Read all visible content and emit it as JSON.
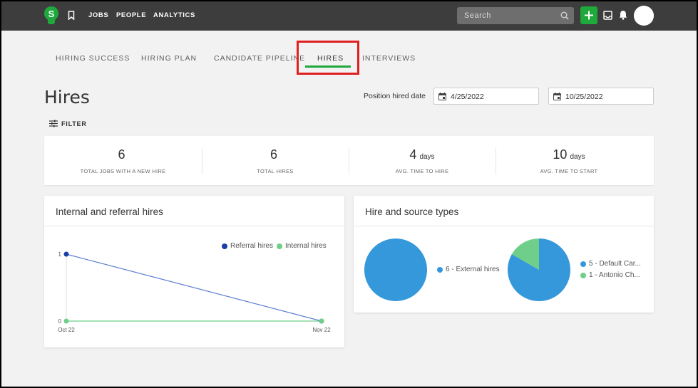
{
  "nav": {
    "logo_letter": "S",
    "links": [
      "JOBS",
      "PEOPLE",
      "ANALYTICS"
    ],
    "search_placeholder": "Search",
    "add_label": "+"
  },
  "tabs": [
    {
      "label": "HIRING SUCCESS"
    },
    {
      "label": "HIRING PLAN"
    },
    {
      "label": "CANDIDATE PIPELINE"
    },
    {
      "label": "HIRES",
      "active": true
    },
    {
      "label": "INTERVIEWS"
    }
  ],
  "page": {
    "title": "Hires",
    "date_label": "Position hired date",
    "date_from": "4/25/2022",
    "date_to": "10/25/2022",
    "filter_label": "FILTER"
  },
  "stats": [
    {
      "value": "6",
      "unit": "",
      "label": "TOTAL JOBS WITH A NEW HIRE"
    },
    {
      "value": "6",
      "unit": "",
      "label": "TOTAL HIRES"
    },
    {
      "value": "4",
      "unit": "days",
      "label": "AVG. TIME TO HIRE"
    },
    {
      "value": "10",
      "unit": "days",
      "label": "AVG. TIME TO START"
    }
  ],
  "colors": {
    "accent_green": "#1fa83b",
    "referral": "#1a3fa3",
    "internal": "#6fcf8a",
    "pie_blue": "#3498db",
    "pie_green": "#6fcf8a",
    "highlight": "#e02020"
  },
  "chart_data": [
    {
      "type": "line",
      "title": "Internal and referral hires",
      "categories": [
        "Oct 22",
        "Nov 22"
      ],
      "yticks": [
        "0",
        "1"
      ],
      "ylim": [
        0,
        1
      ],
      "legend": "top-right",
      "series": [
        {
          "name": "Referral hires",
          "values": [
            1,
            0
          ]
        },
        {
          "name": "Internal hires",
          "values": [
            0,
            0
          ]
        }
      ]
    },
    {
      "type": "pie",
      "title": "Hire and source types",
      "series_label": "6 - External hires",
      "slices": [
        {
          "label": "6 - External hires",
          "value": 6
        }
      ]
    },
    {
      "type": "pie",
      "slices": [
        {
          "label": "5 - Default Car...",
          "value": 5
        },
        {
          "label": "1 - Antonio Ch...",
          "value": 1
        }
      ]
    }
  ]
}
